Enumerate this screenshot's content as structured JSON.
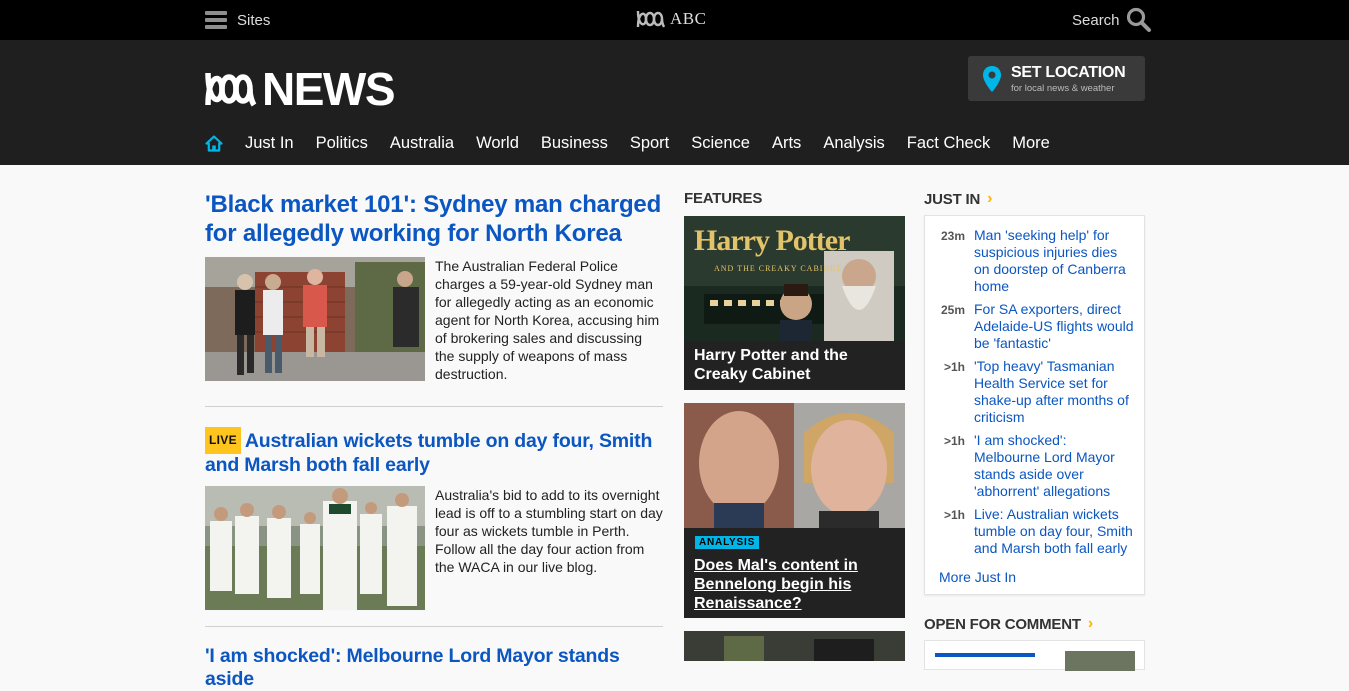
{
  "topbar": {
    "sites_label": "Sites",
    "brand": "ABC",
    "search_label": "Search"
  },
  "header": {
    "logo_text": "NEWS",
    "set_location": {
      "title": "SET LOCATION",
      "subtitle": "for local news & weather"
    },
    "nav": [
      "Just In",
      "Politics",
      "Australia",
      "World",
      "Business",
      "Sport",
      "Science",
      "Arts",
      "Analysis",
      "Fact Check",
      "More"
    ]
  },
  "main": {
    "stories": [
      {
        "title": "'Black market 101': Sydney man charged for allegedly working for North Korea",
        "summary": "The Australian Federal Police charges a 59-year-old Sydney man for allegedly acting as an economic agent for North Korea, accusing him of brokering sales and discussing the supply of weapons of mass destruction."
      },
      {
        "badge": "LIVE",
        "title": "Australian wickets tumble on day four, Smith and Marsh both fall early",
        "summary": "Australia's bid to add to its overnight lead is off to a stumbling start on day four as wickets tumble in Perth. Follow all the day four action from the WACA in our live blog."
      },
      {
        "title": "'I am shocked': Melbourne Lord Mayor stands aside"
      }
    ]
  },
  "features": {
    "heading": "FEATURES",
    "cards": [
      {
        "image_title": "Harry Potter",
        "image_subtitle": "AND THE CREAKY CABINET",
        "caption": "Harry Potter and the Creaky Cabinet"
      },
      {
        "badge": "ANALYSIS",
        "caption": "Does Mal's content in Bennelong begin his Renaissance?"
      }
    ]
  },
  "just_in": {
    "heading": "JUST IN",
    "items": [
      {
        "time": "23m",
        "text": "Man 'seeking help' for suspicious injuries dies on doorstep of Canberra home"
      },
      {
        "time": "25m",
        "text": "For SA exporters, direct Adelaide-US flights would be 'fantastic'"
      },
      {
        "time": ">1h",
        "text": "'Top heavy' Tasmanian Health Service set for shake-up after months of criticism"
      },
      {
        "time": ">1h",
        "text": "'I am shocked': Melbourne Lord Mayor stands aside over 'abhorrent' allegations"
      },
      {
        "time": ">1h",
        "text": "Live: Australian wickets tumble on day four, Smith and Marsh both fall early"
      }
    ],
    "more_label": "More Just In"
  },
  "open_for_comment": {
    "heading": "OPEN FOR COMMENT"
  },
  "colors": {
    "topbar_bg": "#000000",
    "header_bg": "#1f1f1f",
    "link_blue": "#0b56c1",
    "accent_cyan": "#00b6e8",
    "live_yellow": "#ffc41e",
    "chevron_amber": "#ffb400"
  },
  "icons": [
    "menu-icon",
    "abc-logo-icon",
    "search-icon",
    "location-pin-icon",
    "home-icon",
    "chevron-right-icon"
  ]
}
